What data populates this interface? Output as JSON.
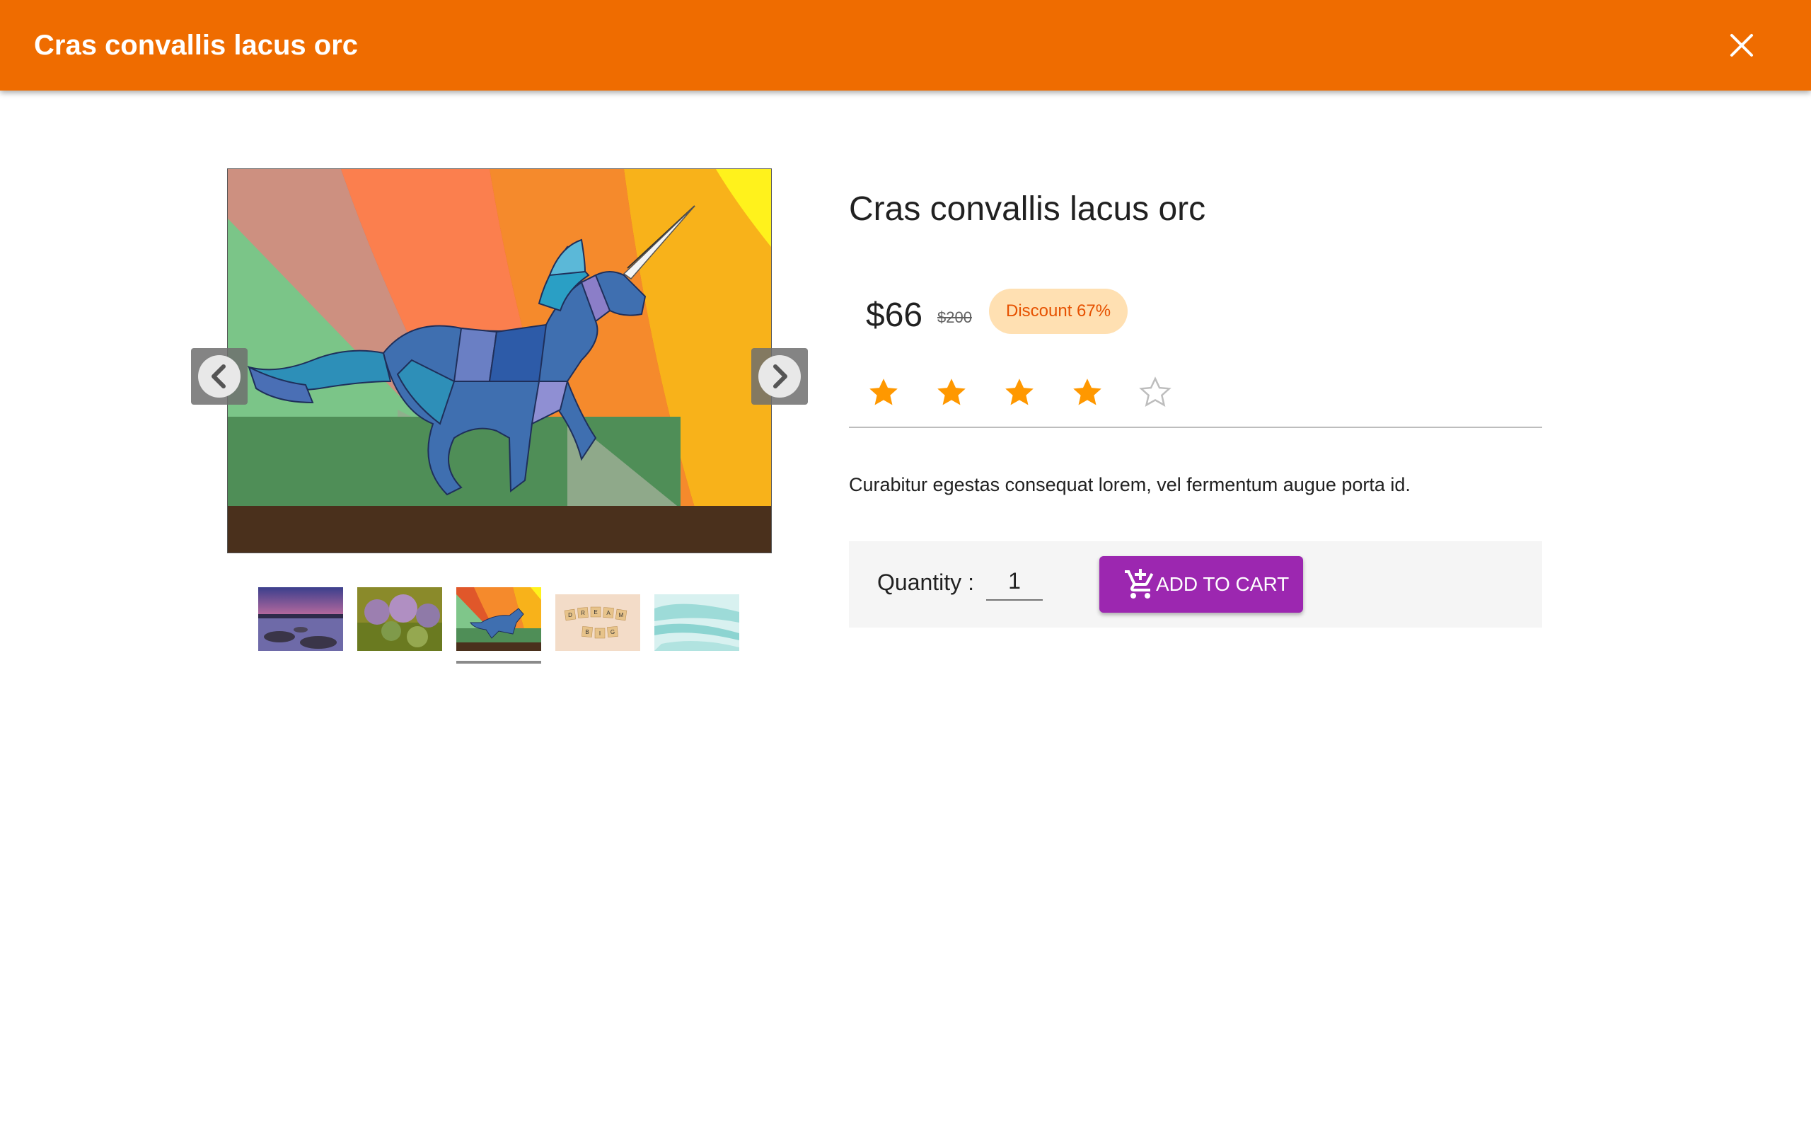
{
  "header": {
    "title": "Cras convallis lacus orc",
    "close_icon": "close-icon"
  },
  "gallery": {
    "thumbnails": [
      {
        "name": "lake-sunset"
      },
      {
        "name": "allium-flowers"
      },
      {
        "name": "unicorn-stained-glass"
      },
      {
        "name": "dream-big-tiles"
      },
      {
        "name": "teal-watercolor"
      }
    ],
    "selected_index": 2,
    "thumb4_tiles_top": [
      "D",
      "R",
      "E",
      "A",
      "M"
    ],
    "thumb4_tiles_bottom": [
      "B",
      "I",
      "G"
    ],
    "prev_icon": "chevron-left-icon",
    "next_icon": "chevron-right-icon"
  },
  "product": {
    "title": "Cras convallis lacus orc",
    "price": "$66",
    "old_price": "$200",
    "discount": "Discount 67%",
    "rating": 4,
    "rating_max": 5,
    "description": "Curabitur egestas consequat lorem, vel fermentum augue porta id."
  },
  "cart": {
    "quantity_label": "Quantity :",
    "quantity_value": "1",
    "add_button_label": "ADD TO CART",
    "add_icon": "add-shopping-cart-icon"
  },
  "colors": {
    "header": "#ef6c00",
    "primary_button": "#9c27b0",
    "star": "#ff9800",
    "discount_bg": "#ffe0b2",
    "discount_text": "#e65100"
  }
}
